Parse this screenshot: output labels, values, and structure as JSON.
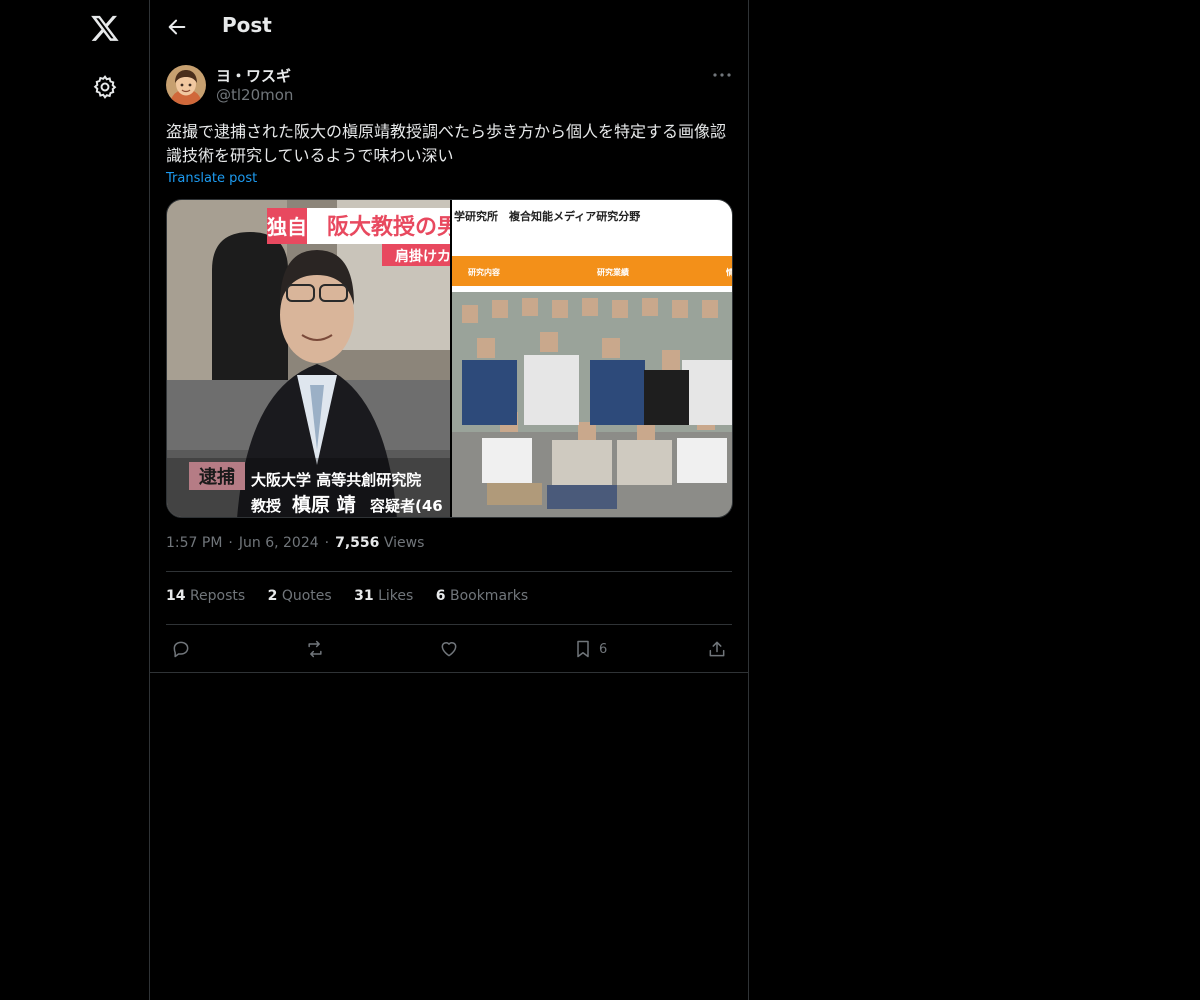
{
  "nav": {
    "logo_icon": "x-logo-icon",
    "settings_icon": "gear-icon"
  },
  "header": {
    "back_icon": "arrow-left-icon",
    "title": "Post"
  },
  "post": {
    "author": {
      "display_name": "ヨ・ワスギ",
      "handle": "@tl20mon"
    },
    "text": "盗撮で逮捕された阪大の槇原靖教授調べたら歩き方から個人を特定する画像認識技術を研究しているようで味わい深い",
    "translate_label": "Translate post",
    "media": {
      "left": {
        "badge_exclusive": "独自",
        "headline": "阪大教授の男",
        "sub_headline": "肩掛けカ",
        "badge_arrest": "逮捕",
        "caption_line1": "大阪大学 高等共創研究院",
        "caption_line2_a": "教授",
        "caption_line2_b": "槙原 靖",
        "caption_line2_c": "容疑者(46"
      },
      "right": {
        "header_text": "学研究所　複合知能メディア研究分野",
        "tab1": "研究内容",
        "tab2": "研究業績",
        "tab3": "情"
      }
    },
    "time": "1:57 PM",
    "date": "Jun 6, 2024",
    "views_count": "7,556",
    "views_label": "Views",
    "stats": [
      {
        "count": "14",
        "label": "Reposts"
      },
      {
        "count": "2",
        "label": "Quotes"
      },
      {
        "count": "31",
        "label": "Likes"
      },
      {
        "count": "6",
        "label": "Bookmarks"
      }
    ],
    "actions": {
      "reply_icon": "reply-icon",
      "repost_icon": "repost-icon",
      "like_icon": "heart-icon",
      "bookmark_icon": "bookmark-icon",
      "bookmark_count": "6",
      "share_icon": "share-icon"
    }
  },
  "colors": {
    "background": "#000000",
    "text": "#e7e9ea",
    "muted": "#71767b",
    "accent": "#1d9bf0",
    "border": "#2f3336"
  }
}
